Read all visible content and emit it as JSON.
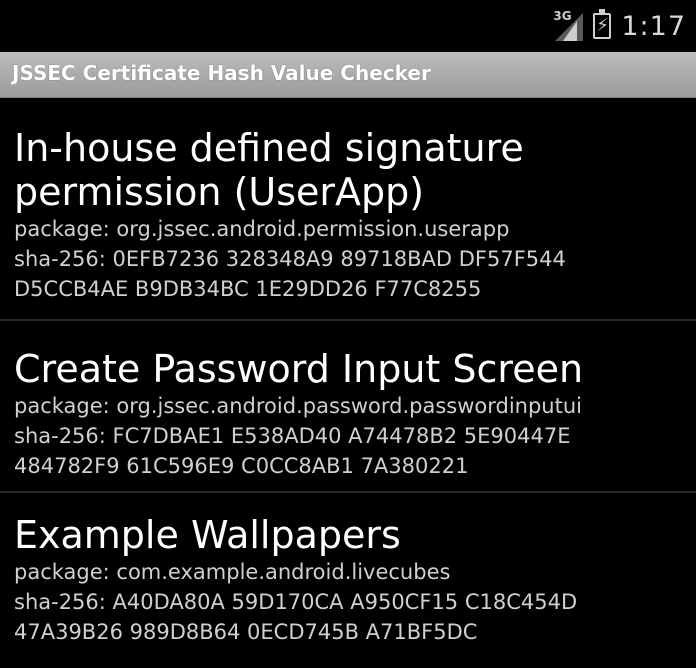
{
  "status_bar": {
    "network": "3G",
    "time": "1:17"
  },
  "app": {
    "title": "JSSEC Certificate Hash Value Checker"
  },
  "items": [
    {
      "name": "In-house defined signature permission (UserApp)",
      "package": "package: org.jssec.android.permission.userapp",
      "sha_line1": "sha-256: 0EFB7236 328348A9 89718BAD DF57F544",
      "sha_line2": "D5CCB4AE B9DB34BC 1E29DD26 F77C8255"
    },
    {
      "name": "Create Password Input Screen",
      "package": "package: org.jssec.android.password.passwordinputui",
      "sha_line1": "sha-256: FC7DBAE1 E538AD40 A74478B2 5E90447E",
      "sha_line2": "484782F9 61C596E9 C0CC8AB1 7A380221"
    },
    {
      "name": "Example Wallpapers",
      "package": "package: com.example.android.livecubes",
      "sha_line1": "sha-256: A40DA80A 59D170CA A950CF15 C18C454D",
      "sha_line2": "47A39B26 989D8B64 0ECD745B A71BF5DC"
    }
  ]
}
